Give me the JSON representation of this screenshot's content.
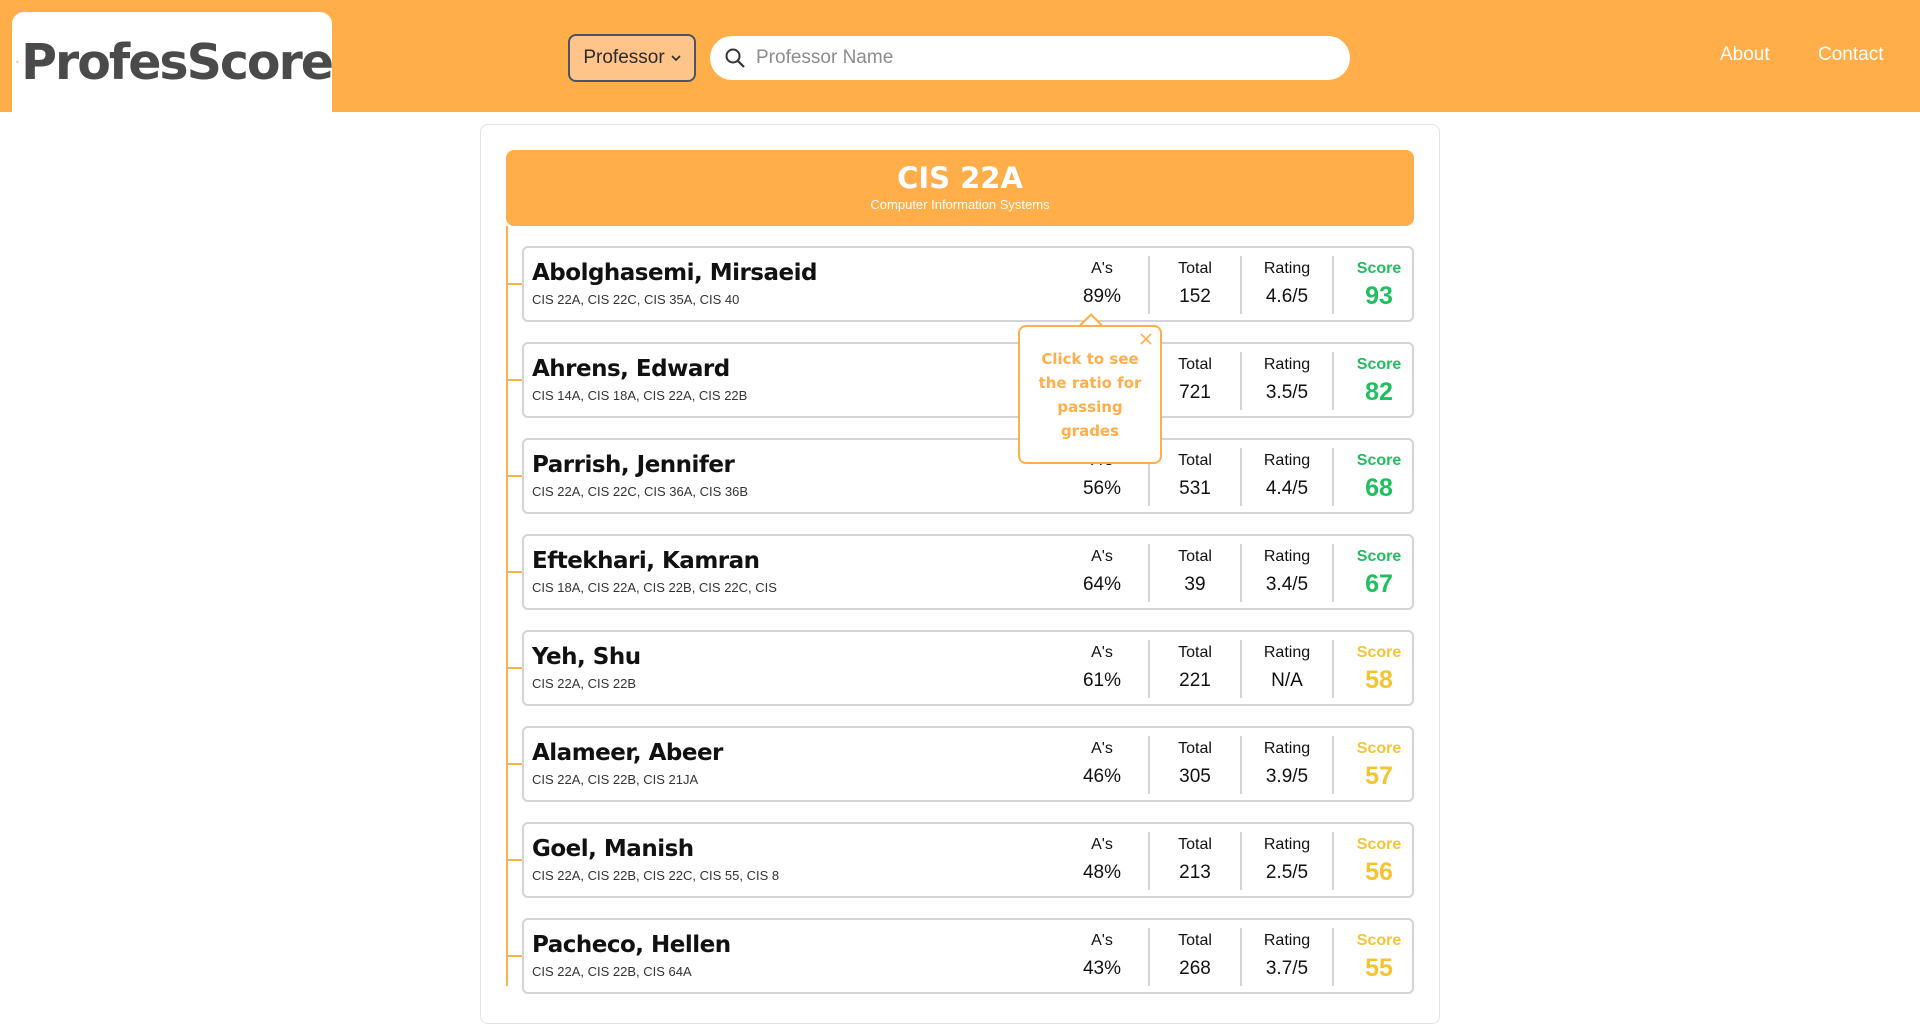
{
  "brand": {
    "logo_text": "ProfesScore",
    "accent": "#ffae4a",
    "logo_color": "#4a4a4a"
  },
  "header": {
    "search_type": "Professor",
    "search_placeholder": "Professor Name",
    "nav": [
      "About",
      "Contact"
    ]
  },
  "course": {
    "code": "CIS 22A",
    "name": "Computer Information Systems"
  },
  "tooltip": {
    "text": "Click to see the ratio for passing grades"
  },
  "labels": {
    "as": "A's",
    "total": "Total",
    "rating": "Rating",
    "score": "Score"
  },
  "score_colors": {
    "high": "#1fbf5f",
    "mid": "#f6c433"
  },
  "professors": [
    {
      "name": "Abolghasemi, Mirsaeid",
      "courses": "CIS 22A, CIS 22C, CIS 35A, CIS 40",
      "as": "89%",
      "total": "152",
      "rating": "4.6/5",
      "score": "93",
      "tier": "high"
    },
    {
      "name": "Ahrens, Edward",
      "courses": "CIS 14A, CIS 18A, CIS 22A, CIS 22B",
      "as": "",
      "total": "721",
      "rating": "3.5/5",
      "score": "82",
      "tier": "high"
    },
    {
      "name": "Parrish, Jennifer",
      "courses": "CIS 22A, CIS 22C, CIS 36A, CIS 36B",
      "as": "56%",
      "total": "531",
      "rating": "4.4/5",
      "score": "68",
      "tier": "high"
    },
    {
      "name": "Eftekhari, Kamran",
      "courses": "CIS 18A, CIS 22A, CIS 22B, CIS 22C, CIS",
      "as": "64%",
      "total": "39",
      "rating": "3.4/5",
      "score": "67",
      "tier": "high"
    },
    {
      "name": "Yeh, Shu",
      "courses": "CIS 22A, CIS 22B",
      "as": "61%",
      "total": "221",
      "rating": "N/A",
      "score": "58",
      "tier": "mid"
    },
    {
      "name": "Alameer, Abeer",
      "courses": "CIS 22A, CIS 22B, CIS 21JA",
      "as": "46%",
      "total": "305",
      "rating": "3.9/5",
      "score": "57",
      "tier": "mid"
    },
    {
      "name": "Goel, Manish",
      "courses": "CIS 22A, CIS 22B, CIS 22C, CIS 55, CIS 8",
      "as": "48%",
      "total": "213",
      "rating": "2.5/5",
      "score": "56",
      "tier": "mid"
    },
    {
      "name": "Pacheco, Hellen",
      "courses": "CIS 22A, CIS 22B, CIS 64A",
      "as": "43%",
      "total": "268",
      "rating": "3.7/5",
      "score": "55",
      "tier": "mid"
    }
  ]
}
